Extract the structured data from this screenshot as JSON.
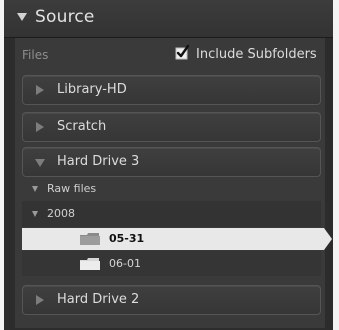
{
  "panel": {
    "title": "Source",
    "files_label": "Files",
    "include_subfolders": {
      "label": "Include Subfolders",
      "checked": true
    }
  },
  "volumes": [
    {
      "label": "Library-HD",
      "expanded": false
    },
    {
      "label": "Scratch",
      "expanded": false
    },
    {
      "label": "Hard Drive 3",
      "expanded": true
    },
    {
      "label": "Hard Drive 2",
      "expanded": false
    }
  ],
  "tree": {
    "rawfiles": "Raw files",
    "year": "2008",
    "folders": [
      {
        "label": "05-31",
        "selected": true
      },
      {
        "label": "06-01",
        "selected": false
      }
    ]
  },
  "icons": {
    "panel_toggle": "disclosure-down-icon",
    "checkbox": "checkmark-icon",
    "folder": "folder-icon"
  },
  "colors": {
    "panel_bg": "#2c2c2c",
    "inner_bg": "#3a3a3a",
    "selection": "#e8e8e8",
    "text": "#dcdcdc"
  }
}
